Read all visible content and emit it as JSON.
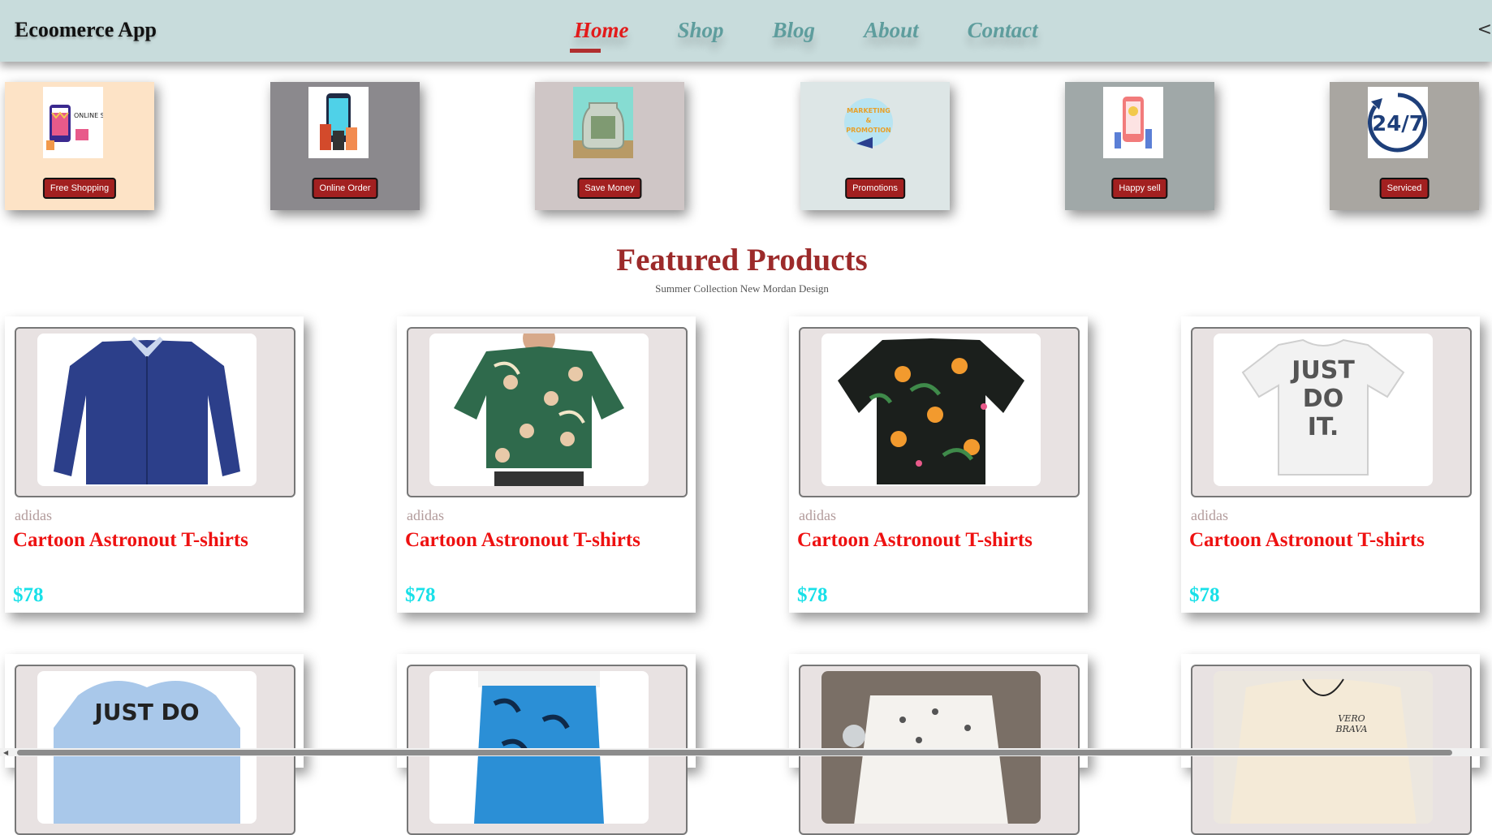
{
  "nav": {
    "brand": "Ecoomerce App",
    "items": [
      {
        "label": "Home",
        "active": true
      },
      {
        "label": "Shop",
        "active": false
      },
      {
        "label": "Blog",
        "active": false
      },
      {
        "label": "About",
        "active": false
      },
      {
        "label": "Contact",
        "active": false
      }
    ],
    "edge_glyph": "<"
  },
  "features": [
    {
      "button": "Free Shopping",
      "bg": "#fde3c6",
      "icon": "online-shopping-icon"
    },
    {
      "button": "Online Order",
      "bg": "#8b898d",
      "icon": "mobile-order-icon"
    },
    {
      "button": "Save Money",
      "bg": "#cfc6c6",
      "icon": "money-jar-icon"
    },
    {
      "button": "Promotions",
      "bg": "#dde6e6",
      "icon": "marketing-promotion-icon"
    },
    {
      "button": "Happy sell",
      "bg": "#a0a8a8",
      "icon": "happy-sell-icon"
    },
    {
      "button": "Serviced",
      "bg": "#a9a6a1",
      "icon": "24-7-service-icon"
    }
  ],
  "featured": {
    "title": "Featured Products",
    "subtitle": "Summer Collection New Mordan Design"
  },
  "products": [
    {
      "brand": "adidas",
      "name": "Cartoon Astronout T-shirts",
      "price": "$78",
      "image": "navy-dress-shirt"
    },
    {
      "brand": "adidas",
      "name": "Cartoon Astronout T-shirts",
      "price": "$78",
      "image": "tropical-face-print-shirt"
    },
    {
      "brand": "adidas",
      "name": "Cartoon Astronout T-shirts",
      "price": "$78",
      "image": "black-floral-hawaiian-shirt"
    },
    {
      "brand": "adidas",
      "name": "Cartoon Astronout T-shirts",
      "price": "$78",
      "image": "white-just-do-it-tshirt"
    }
  ],
  "products_row2": [
    {
      "image": "light-blue-just-do-tshirt",
      "text": "JUST DO"
    },
    {
      "image": "blue-palm-shorts"
    },
    {
      "image": "white-printed-shirt"
    },
    {
      "image": "cream-sweatshirt",
      "text": "VERO BRAVA"
    }
  ],
  "feature_icon_texts": {
    "shop": "ONLINE SHOPPING",
    "promo": "MARKETING & PROMOTION",
    "service": "24/7"
  },
  "photo_texts": {
    "just_do_it": "JUST DO IT."
  },
  "colors": {
    "nav_bg": "#c8dcdc",
    "nav_active": "#e21a1a",
    "nav_link": "#5e9d9d",
    "title": "#9c2a2a",
    "product_name": "#ee1111",
    "price": "#18e0e8",
    "button": "#a22020"
  }
}
